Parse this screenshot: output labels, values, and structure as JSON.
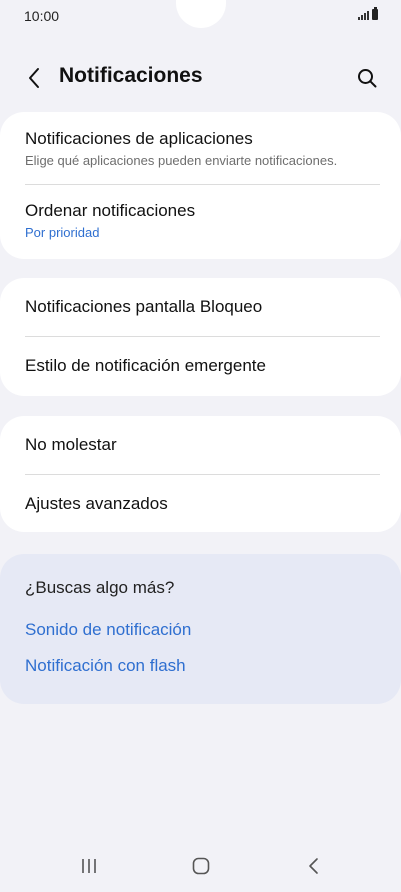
{
  "status_bar": {
    "time": "10:00"
  },
  "header": {
    "title": "Notificaciones"
  },
  "group1": {
    "app_notifications": {
      "title": "Notificaciones de aplicaciones",
      "subtitle": "Elige qué aplicaciones pueden enviarte notificaciones."
    },
    "sort_notifications": {
      "title": "Ordenar notificaciones",
      "value": "Por prioridad"
    }
  },
  "group2": {
    "lock_screen": "Notificaciones pantalla Bloqueo",
    "popup_style": "Estilo de notificación emergente"
  },
  "group3": {
    "do_not_disturb": "No molestar",
    "advanced": "Ajustes avanzados"
  },
  "suggestions": {
    "title": "¿Buscas algo más?",
    "links": [
      "Sonido de notificación",
      "Notificación con flash"
    ]
  },
  "colors": {
    "background": "#f2f2f7",
    "card": "#ffffff",
    "suggest_card": "#e6e9f5",
    "accent_blue": "#2f6fd0"
  },
  "icons": [
    "back-arrow-icon",
    "search-icon",
    "recent-apps-icon",
    "home-icon",
    "back-nav-icon",
    "signal-icon",
    "battery-icon"
  ]
}
